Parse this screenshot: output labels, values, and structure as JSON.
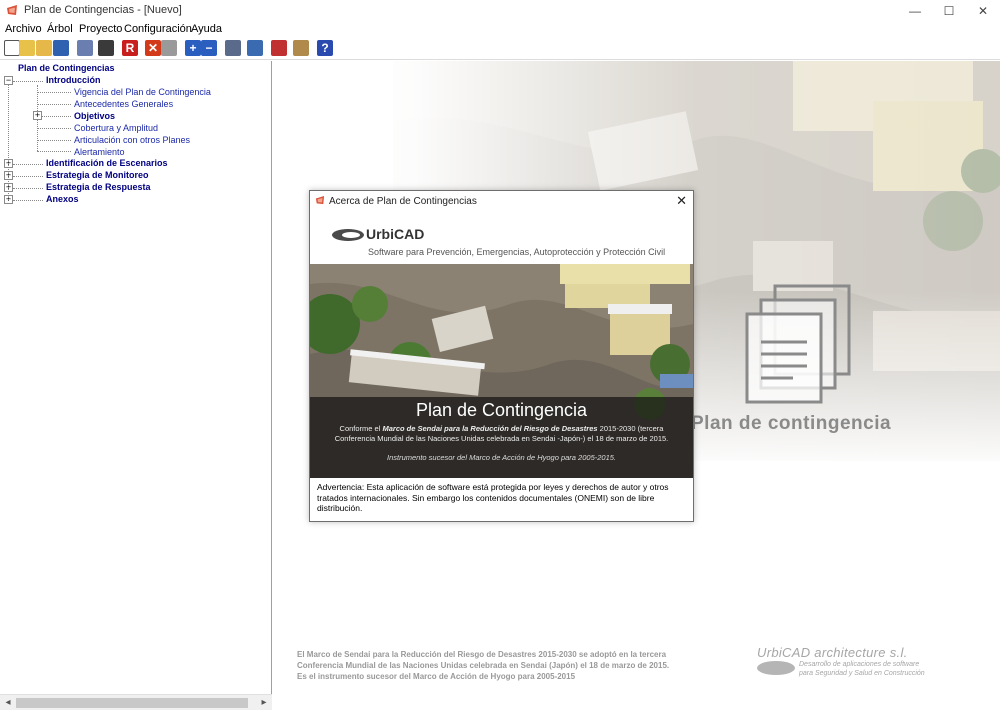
{
  "window": {
    "title": "Plan de Contingencias - [Nuevo]",
    "controls": {
      "minimize": "—",
      "maximize": "☐",
      "close": "✕"
    }
  },
  "menubar": {
    "items": [
      "Archivo",
      "Árbol",
      "Proyecto",
      "Configuración",
      "Ayuda"
    ]
  },
  "toolbar": {
    "buttons": [
      {
        "name": "new-icon",
        "glyph": "",
        "color": "#ffffff"
      },
      {
        "name": "wand-icon",
        "glyph": "",
        "color": "#e8c14a"
      },
      {
        "name": "open-folder-icon",
        "glyph": "",
        "color": "#e6b84a"
      },
      {
        "name": "save-icon",
        "glyph": "",
        "color": "#3060b0"
      },
      {
        "name": "print-preview-icon",
        "glyph": "",
        "color": "#6a7fb0"
      },
      {
        "name": "binoculars-icon",
        "glyph": "",
        "color": "#3a3a3a"
      },
      {
        "name": "r-icon",
        "glyph": "R",
        "color": "#c81e1e"
      },
      {
        "name": "delete-icon",
        "glyph": "✕",
        "color": "#d23a1a"
      },
      {
        "name": "trash-icon",
        "glyph": "",
        "color": "#9a9a9a"
      },
      {
        "name": "add-icon",
        "glyph": "+",
        "color": "#2a5fc0"
      },
      {
        "name": "remove-icon",
        "glyph": "−",
        "color": "#2a5fc0"
      },
      {
        "name": "edit-doc-icon",
        "glyph": "",
        "color": "#5a6a8a"
      },
      {
        "name": "pencil-icon",
        "glyph": "",
        "color": "#3a6ab0"
      },
      {
        "name": "pdf-icon",
        "glyph": "",
        "color": "#c03030"
      },
      {
        "name": "export-icon",
        "glyph": "",
        "color": "#b08a4a"
      },
      {
        "name": "help-icon",
        "glyph": "?",
        "color": "#2a4ab0"
      }
    ]
  },
  "tree": {
    "root": "Plan de Contingencias",
    "introduccion": "Introducción",
    "children_intro": [
      "Vigencia del Plan de Contingencia",
      "Antecedentes Generales",
      "Objetivos",
      "Cobertura y Amplitud",
      "Articulación con otros Planes",
      "Alertamiento"
    ],
    "top_nodes": [
      "Identificación de Escenarios",
      "Estrategia de Monitoreo",
      "Estrategia de Respuesta",
      "Anexos"
    ],
    "expand_minus": "−",
    "expand_plus": "+"
  },
  "hscroll": {
    "left": "◂",
    "right": "▸"
  },
  "background": {
    "brand_text": "Plan de contingencia",
    "footer_lines": [
      "El Marco de Sendai para la Reducción del Riesgo de Desastres 2015-2030 se adoptó en la tercera",
      "Conferencia Mundial de las Naciones Unidas celebrada en Sendai (Japón) el 18 de marzo de 2015.",
      "Es el instrumento sucesor del Marco de Acción de Hyogo para 2005-2015"
    ],
    "footer_logo_name": "UrbiCAD architecture s.l.",
    "footer_logo_tag1": "Desarrollo de aplicaciones de software",
    "footer_logo_tag2": "para Seguridad y Salud en Construcción"
  },
  "dialog": {
    "title": "Acerca de Plan de Contingencias",
    "close": "✕",
    "logo_name": "UrbiCAD",
    "subtitle": "Software para Prevención, Emergencias, Autoprotección y Protección Civil",
    "photo_title": "Plan de Contingencia",
    "photo_desc_prefix": "Conforme el ",
    "photo_desc_em": "Marco de Sendai para la Reducción del Riesgo de Desastres",
    "photo_desc_suffix": " 2015-2030 (tercera Conferencia Mundial de las Naciones Unidas celebrada en Sendai -Japón-) el 18 de marzo de 2015.",
    "photo_note": "Instrumento sucesor del Marco de Acción de Hyogo para 2005-2015.",
    "warning": "Advertencia: Esta aplicación de software está protegida por leyes y derechos de autor y otros tratados internacionales. Sin embargo los contenidos documentales (ONEMI) son de libre distribución."
  }
}
